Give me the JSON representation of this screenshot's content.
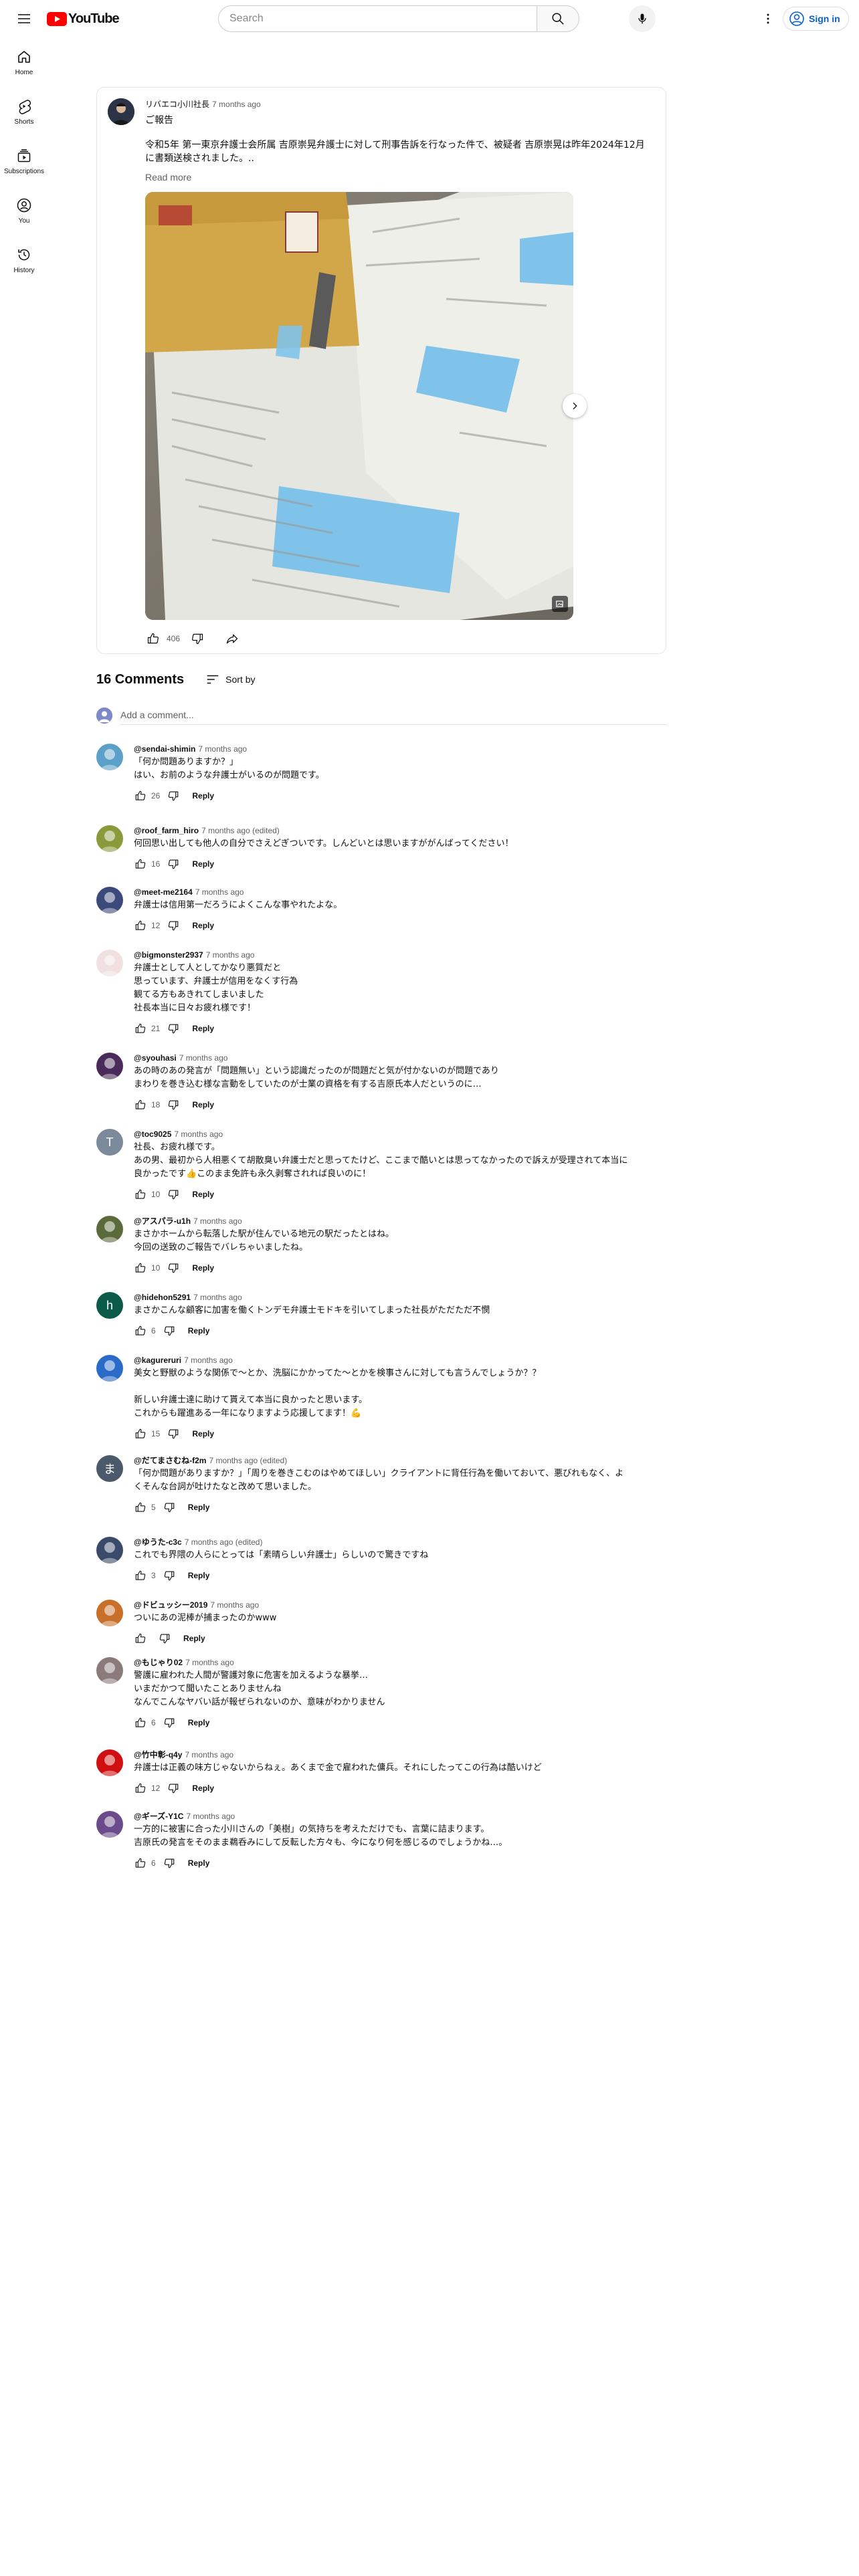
{
  "header": {
    "logo_text": "YouTube",
    "search_placeholder": "Search",
    "signin_label": "Sign in"
  },
  "guide": {
    "items": [
      {
        "label": "Home",
        "icon": "home-icon"
      },
      {
        "label": "Shorts",
        "icon": "shorts-icon"
      },
      {
        "label": "Subscriptions",
        "icon": "subscriptions-icon"
      },
      {
        "label": "You",
        "icon": "you-icon"
      },
      {
        "label": "History",
        "icon": "history-icon"
      }
    ]
  },
  "post": {
    "author": "リバエコ小川社長",
    "time": "7 months ago",
    "title": "ご報告",
    "body": "令和5年 第一東京弁護士会所属 吉原崇晃弁護士に対して刑事告訴を行なった件で、被疑者 吉原崇晃は昨年2024年12月に書類送検されました。..",
    "read_more": "Read more",
    "like_count": "406",
    "image_description": "document-photo"
  },
  "comments_header": {
    "count": "16 Comments",
    "sort_label": "Sort by",
    "add_placeholder": "Add a comment..."
  },
  "reply_label": "Reply",
  "comments": [
    {
      "author": "@sendai-shimin",
      "time": "7 months ago",
      "lines": [
        "「何か問題ありますか？」",
        "はい、お前のような弁護士がいるのが問題です。"
      ],
      "likes": "26",
      "avatar_color": "#5aa0c8"
    },
    {
      "author": "@roof_farm_hiro",
      "time": "7 months ago (edited)",
      "lines": [
        "何回思い出しても他人の自分でさえどぎついです。しんどいとは思いますががんばってください！"
      ],
      "likes": "16",
      "avatar_color": "#8a9a3a"
    },
    {
      "author": "@meet-me2164",
      "time": "7 months ago",
      "lines": [
        "弁護士は信用第一だろうによくこんな事やれたよな。"
      ],
      "likes": "12",
      "avatar_color": "#3b4a7a"
    },
    {
      "author": "@bigmonster2937",
      "time": "7 months ago",
      "lines": [
        "弁護士として人としてかなり悪質だと",
        "思っています、弁護士が信用をなくす行為",
        "観てる方もあきれてしまいました",
        "社長本当に日々お疲れ様です！"
      ],
      "likes": "21",
      "avatar_color": "#f0e0e0"
    },
    {
      "author": "@syouhasi",
      "time": "7 months ago",
      "lines": [
        "あの時のあの発言が「問題無い」という認識だったのが問題だと気が付かないのが問題であり",
        "まわりを巻き込む様な言動をしていたのが士業の資格を有する吉原氏本人だというのに…"
      ],
      "likes": "18",
      "avatar_color": "#4a2a5a"
    },
    {
      "author": "@toc9025",
      "time": "7 months ago",
      "lines": [
        "社長、お疲れ様です。",
        "あの男、最初から人相悪くて胡散臭い弁護士だと思ってたけど、ここまで酷いとは思ってなかったので訴えが受理されて本当に",
        "良かったです👍このまま免許も永久剥奪されれば良いのに！"
      ],
      "likes": "10",
      "avatar_color": "#7a8a9a",
      "avatar_letter": "T"
    },
    {
      "author": "@アスパラ-u1h",
      "time": "7 months ago",
      "lines": [
        "まさかホームから転落した駅が住んでいる地元の駅だったとはね。",
        "今回の送致のご報告でバレちゃいましたね。"
      ],
      "likes": "10",
      "avatar_color": "#5a6a3a"
    },
    {
      "author": "@hidehon5291",
      "time": "7 months ago",
      "lines": [
        "まさかこんな顧客に加害を働くトンデモ弁護士モドキを引いてしまった社長がただただ不憫"
      ],
      "likes": "6",
      "avatar_color": "#0b5a4a",
      "avatar_letter": "h"
    },
    {
      "author": "@kagureruri",
      "time": "7 months ago",
      "lines": [
        "美女と野獣のような関係で〜とか、洗脳にかかってた〜とかを検事さんに対しても言うんでしょうか？？",
        "",
        "新しい弁護士達に助けて貰えて本当に良かったと思います。",
        "これからも躍進ある一年になりますよう応援してます！💪"
      ],
      "likes": "15",
      "avatar_color": "#2a6ac8"
    },
    {
      "author": "@だてまさむね-f2m",
      "time": "7 months ago (edited)",
      "lines": [
        "「何か問題がありますか？」「周りを巻きこむのはやめてほしい」クライアントに背任行為を働いておいて、悪びれもなく、よ",
        "くそんな台詞が吐けたなと改めて思いました。"
      ],
      "likes": "5",
      "avatar_color": "#4a5a6a",
      "avatar_letter": "ま"
    },
    {
      "author": "@ゆうた-c3c",
      "time": "7 months ago (edited)",
      "lines": [
        "これでも界隈の人らにとっては「素晴らしい弁護士」らしいので驚きですね"
      ],
      "likes": "3",
      "avatar_color": "#3a4a6a"
    },
    {
      "author": "@ドビュッシー2019",
      "time": "7 months ago",
      "lines": [
        "ついにあの泥棒が捕まったのかwww"
      ],
      "likes": "",
      "avatar_color": "#c8702a"
    },
    {
      "author": "@もじゃり02",
      "time": "7 months ago",
      "lines": [
        "警護に雇われた人間が警護対象に危害を加えるような暴挙…",
        "いまだかつて聞いたことありませんね",
        "なんでこんなヤバい話が報ぜられないのか、意味がわかりません"
      ],
      "likes": "6",
      "avatar_color": "#8a7a7a"
    },
    {
      "author": "@竹中彰-q4y",
      "time": "7 months ago",
      "lines": [
        "弁護士は正義の味方じゃないからねぇ。あくまで金で雇われた傭兵。それにしたってこの行為は酷いけど"
      ],
      "likes": "12",
      "avatar_color": "#d01010"
    },
    {
      "author": "@ギーズ-Y1C",
      "time": "7 months ago",
      "lines": [
        "一方的に被害に合った小川さんの「美樹」の気持ちを考えただけでも、言葉に詰まります。",
        "吉原氏の発言をそのまま鵜呑みにして反転した方々も、今になり何を感じるのでしょうかね…。"
      ],
      "likes": "6",
      "avatar_color": "#6a4a8a"
    }
  ],
  "colors": {
    "brand_red": "#ff0000",
    "link_blue": "#065fd4",
    "secondary_text": "#606060"
  }
}
